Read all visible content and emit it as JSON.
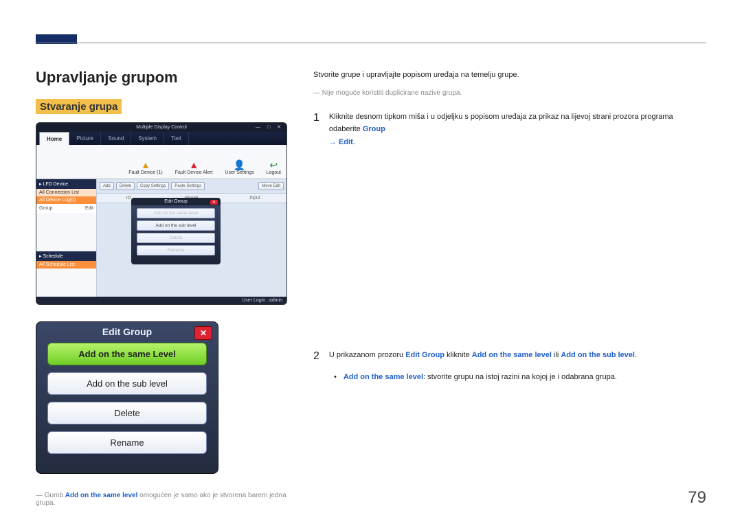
{
  "page_number": "79",
  "heading_main": "Upravljanje grupom",
  "heading_sub": "Stvaranje grupa",
  "intro_text": "Stvorite grupe i upravljajte popisom uređaja na temelju grupe.",
  "intro_note": "― Nije moguće koristiti duplicirane nazive grupa.",
  "step1": {
    "num": "1",
    "text_a": "Kliknite desnom tipkom miša i u odjeljku s popisom uređaja za prikaz na lijevoj strani prozora programa odaberite ",
    "hl_a": "Group",
    "arrow": " → ",
    "hl_b": "Edit",
    "end": "."
  },
  "step2": {
    "num": "2",
    "text_a": "U prikazanom prozoru ",
    "hl_a": "Edit Group",
    "text_b": " kliknite ",
    "hl_b": "Add on the same level",
    "text_c": " ili ",
    "hl_c": "Add on the sub level",
    "end": "."
  },
  "bullet1": {
    "hl": "Add on the same level",
    "text": ": stvorite grupu na istoj razini na kojoj je i odabrana grupa."
  },
  "foot_note": {
    "prefix": "― Gumb ",
    "hl": "Add on the same level",
    "suffix": " omogućen je samo ako je stvorena barem jedna grupa."
  },
  "screenshot1": {
    "title": "Multiple Display Control",
    "tabs": [
      "Home",
      "Picture",
      "Sound",
      "System",
      "Tool"
    ],
    "tool_icons": [
      {
        "glyph": "▲",
        "label": "Fault Device\n(1)",
        "color": "#e59b16"
      },
      {
        "glyph": "▲",
        "label": "Fault Device\nAlert",
        "color": "#d23"
      },
      {
        "glyph": "👤",
        "label": "User Settings",
        "color": "#2a5fb3"
      },
      {
        "glyph": "↩",
        "label": "Logout",
        "color": "#2a8a3a"
      }
    ],
    "sidebar": {
      "lfd_hd": "▸ LFD Device",
      "all_conn": "All Connection List",
      "all_dev": "All Device Log(0)",
      "group_label": "Group",
      "edit_label": "Edit",
      "sched_hd": "▸ Schedule",
      "sched_list": "All Schedule List"
    },
    "main_buttons": [
      "Add",
      "Delete",
      "Copy Settings",
      "Paste Settings"
    ],
    "move_edit": "Move Edit",
    "cols": [
      "ID",
      "Power",
      "Input"
    ],
    "floater_title": "Edit Group",
    "floater_buttons": [
      "Add on the same level",
      "Add on the sub level",
      "Delete",
      "Rename"
    ],
    "statusbar": "User Login : admin"
  },
  "screenshot2": {
    "title": "Edit Group",
    "buttons": [
      "Add on the same Level",
      "Add on the sub level",
      "Delete",
      "Rename"
    ]
  }
}
